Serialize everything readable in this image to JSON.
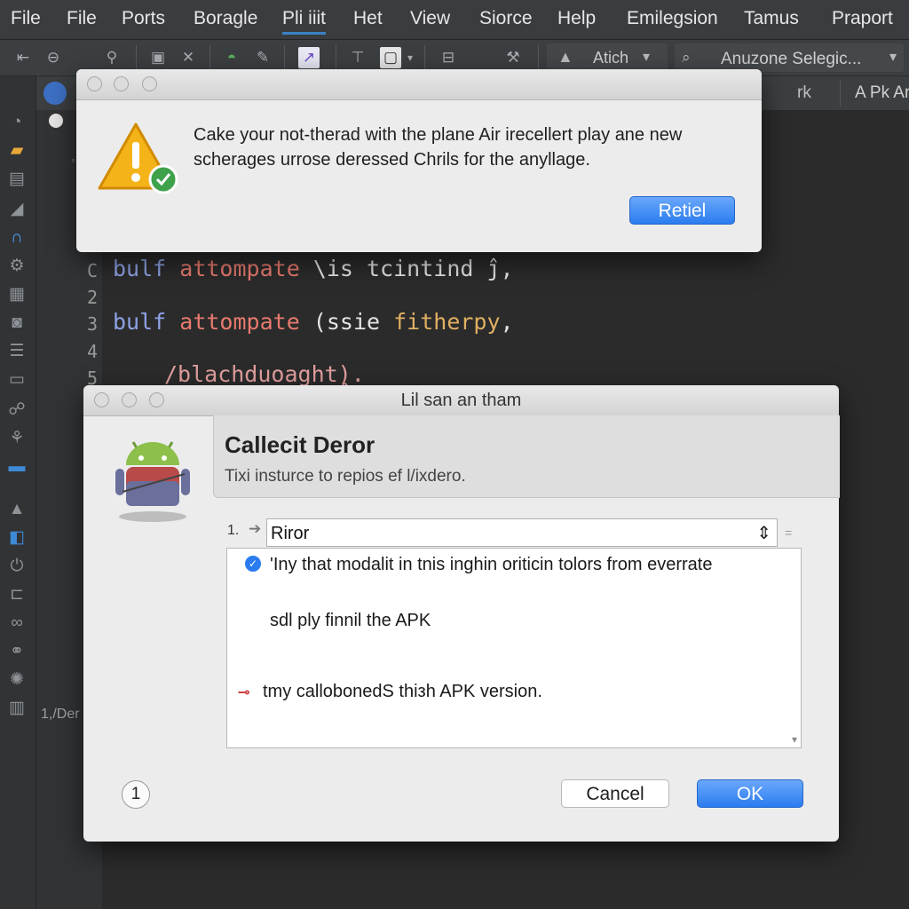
{
  "menu": {
    "items": [
      "File",
      "File",
      "Ports",
      "Boragle",
      "Pli iiit",
      "Het",
      "View",
      "Siorce",
      "Help",
      "Emilegsion",
      "Tamus",
      "Praport"
    ],
    "active_index": 4
  },
  "toolbar": {
    "attach_label": "Atich",
    "select_label": "Anuzone Selegic..."
  },
  "tabs": {
    "project_label": "rk",
    "right_label": "A Pk Armol"
  },
  "editor": {
    "line_numbers": [
      "C",
      "2",
      "3",
      "4",
      "5"
    ],
    "line1": {
      "kw": "bulf",
      "fn": "attompate",
      "rest": " \\is tcintind ĵ,"
    },
    "line3": {
      "kw": "bulf",
      "fn": "attompate",
      "rest": " (ssie ",
      "str": "fitherpy",
      "end": ","
    },
    "line5": {
      "text": "/blachduoaghtຸ)."
    },
    "status_text": "1,/Der"
  },
  "dialog1": {
    "message_line1": "Cake your not-therad with the plane Air irecellert play ane new",
    "message_line2": "scherages urrose deressed Chrils for the anyllage.",
    "button": "Retiel"
  },
  "dialog2": {
    "title": "Lil san an tham",
    "heading": "Callecit Deror",
    "subtitle": "Tixi insturce to repios ef l/ixdero.",
    "row_number": "1.",
    "select_value": "Riror",
    "list_items": [
      "'Iny that modalit in tnis inghin oriticin tolors from everrate",
      "sdl ply finnil the APK",
      "tmy callobonedS thiзh APK version."
    ],
    "help_label": "1",
    "cancel_button": "Cancel",
    "ok_button": "OK"
  },
  "colors": {
    "accent": "#2a7cf0",
    "warning": "#f5b31a",
    "android_green": "#8cc04a"
  }
}
